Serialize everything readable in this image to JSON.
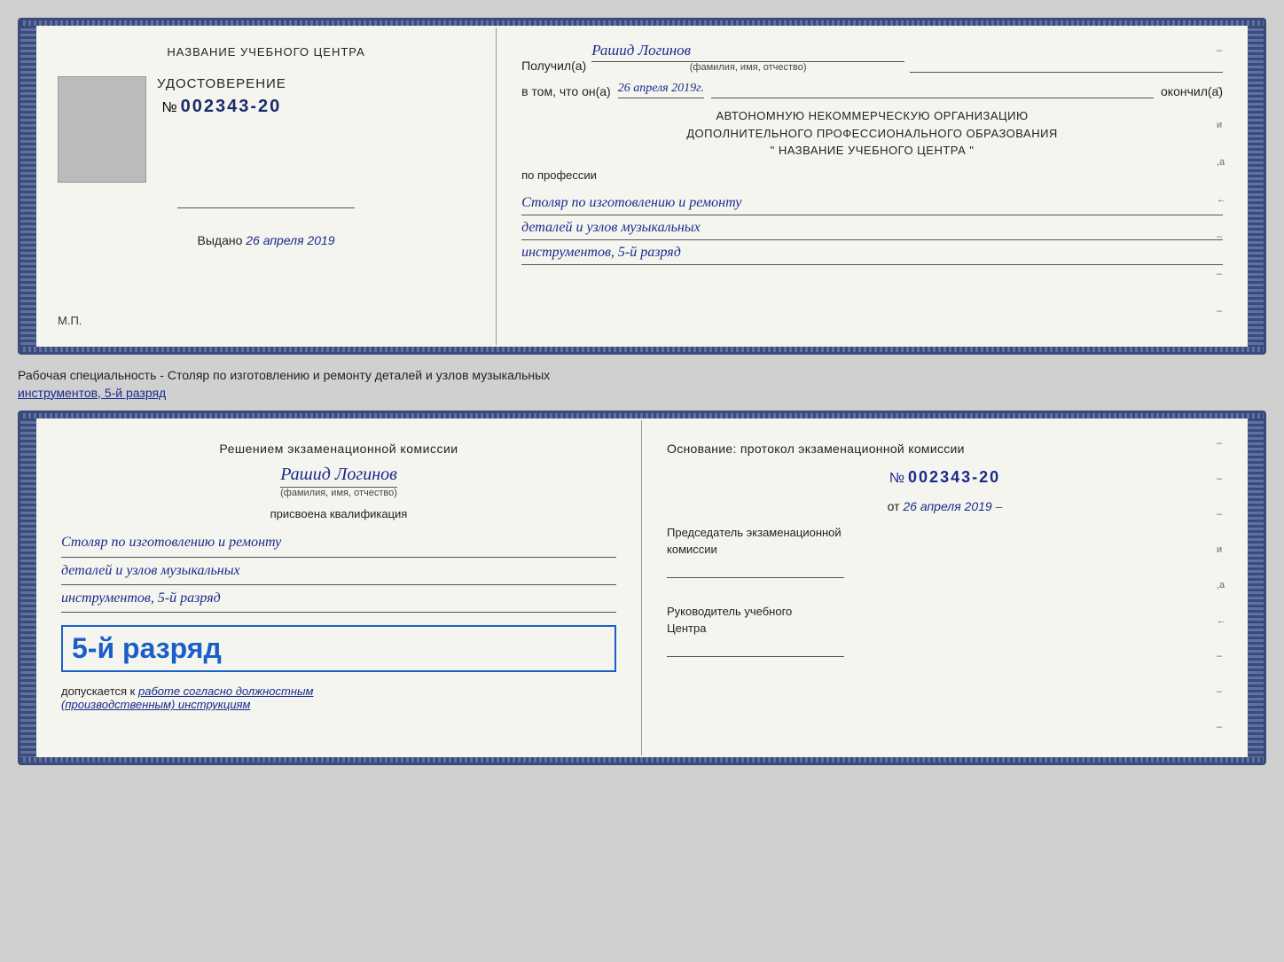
{
  "top_certificate": {
    "left": {
      "center_name": "НАЗВАНИЕ УЧЕБНОГО ЦЕНТРА",
      "udostoverenie_title": "УДОСТОВЕРЕНИЕ",
      "number_prefix": "№",
      "number": "002343-20",
      "vydano_label": "Выдано",
      "vydano_date": "26 апреля 2019",
      "mp_label": "М.П."
    },
    "right": {
      "poluchil_label": "Получил(а)",
      "poluchil_name": "Рашид Логинов",
      "fio_label": "(фамилия, имя, отчество)",
      "vtom_label": "в том, что он(а)",
      "vtom_date": "26 апреля 2019г.",
      "okonchil_label": "окончил(а)",
      "autonomous_line1": "АВТОНОМНУЮ НЕКОММЕРЧЕСКУЮ ОРГАНИЗАЦИЮ",
      "autonomous_line2": "ДОПОЛНИТЕЛЬНОГО ПРОФЕССИОНАЛЬНОГО ОБРАЗОВАНИЯ",
      "autonomous_line3": "\"  НАЗВАНИЕ УЧЕБНОГО ЦЕНТРА  \"",
      "po_professii": "по профессии",
      "profession_line1": "Столяр по изготовлению и ремонту",
      "profession_line2": "деталей и узлов музыкальных",
      "profession_line3": "инструментов, 5-й разряд"
    }
  },
  "separator": {
    "text": "Рабочая специальность - Столяр по изготовлению и ремонту деталей и узлов музыкальных",
    "text2": "инструментов, 5-й разряд"
  },
  "bottom_certificate": {
    "left": {
      "resheniem_title": "Решением экзаменационной комиссии",
      "name": "Рашид Логинов",
      "fio_label": "(фамилия, имя, отчество)",
      "prisvoyena": "присвоена квалификация",
      "profession_line1": "Столяр по изготовлению и ремонту",
      "profession_line2": "деталей и узлов музыкальных",
      "profession_line3": "инструментов, 5-й разряд",
      "rank_text": "5-й разряд",
      "dopuskaetsya_label": "допускается к",
      "dopuskaetsya_value": "работе согласно должностным",
      "dopuskaetsya_value2": "(производственным) инструкциям"
    },
    "right": {
      "osnovanie_label": "Основание: протокол экзаменационной комиссии",
      "number_prefix": "№",
      "number": "002343-20",
      "ot_label": "от",
      "date": "26 апреля 2019",
      "predsedatel_title": "Председатель экзаменационной",
      "predsedatel_title2": "комиссии",
      "rukovoditel_title": "Руководитель учебного",
      "rukovoditel_title2": "Центра"
    }
  }
}
